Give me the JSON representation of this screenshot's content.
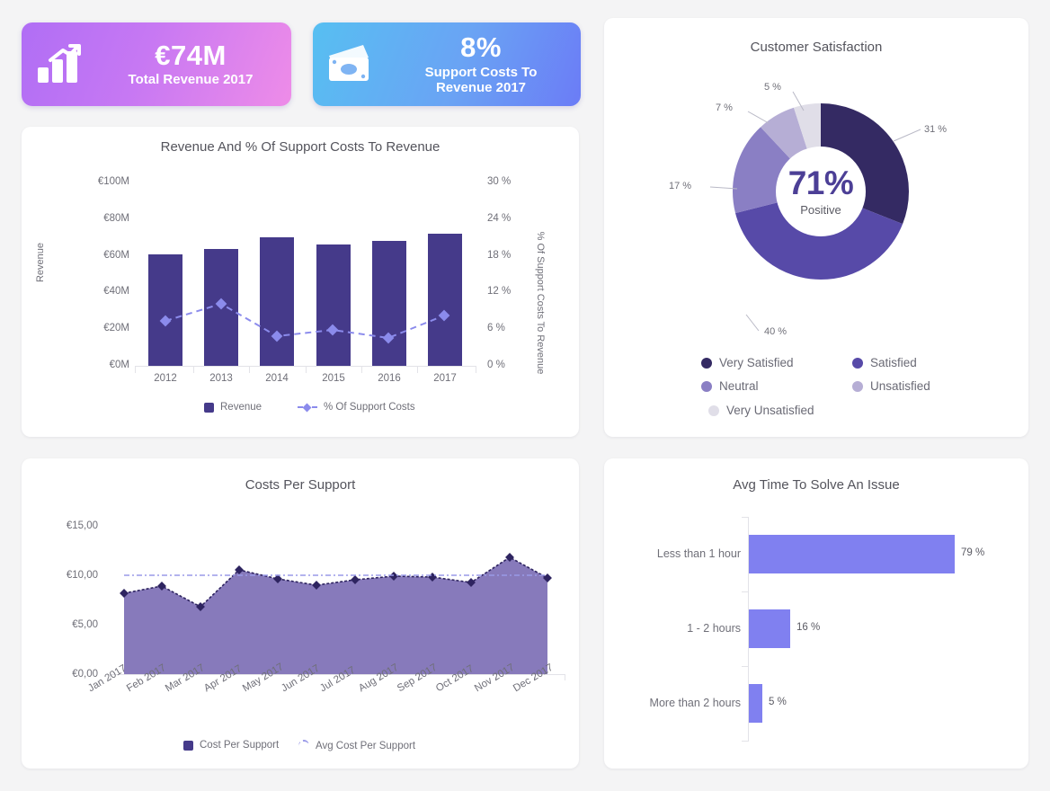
{
  "kpis": [
    {
      "id": "total-revenue",
      "icon": "bar-chart-growth-icon",
      "value": "€74M",
      "label_line1": "Total Revenue 2017",
      "label_line2": "",
      "color_from": "#b06ef5",
      "color_to": "#ee8ce8"
    },
    {
      "id": "support-costs",
      "icon": "money-cash-icon",
      "value": "8%",
      "label_line1": "Support Costs To",
      "label_line2": "Revenue 2017",
      "color_from": "#57bff2",
      "color_to": "#6b7cf6"
    }
  ],
  "chart_data": [
    {
      "id": "revenue-combo",
      "type": "bar",
      "title": "Revenue And % Of Support Costs To Revenue",
      "xlabel": "",
      "ylabel": "Revenue",
      "y2label": "% Of Support Costs To Revenue",
      "categories": [
        "2012",
        "2013",
        "2014",
        "2015",
        "2016",
        "2017"
      ],
      "ylim": [
        0,
        100
      ],
      "yticks": [
        "€0M",
        "€20M",
        "€40M",
        "€60M",
        "€80M",
        "€100M"
      ],
      "y2lim": [
        0,
        30
      ],
      "y2ticks": [
        "0 %",
        "6 %",
        "12 %",
        "18 %",
        "24 %",
        "30 %"
      ],
      "series": [
        {
          "name": "Revenue",
          "type": "bar",
          "color": "#453a8a",
          "values": [
            61,
            64,
            70,
            66,
            68,
            72
          ]
        },
        {
          "name": "% Of Support Costs",
          "type": "line",
          "color": "#8b8bec",
          "values": [
            7.4,
            10.3,
            5.0,
            6.0,
            4.7,
            8.4
          ]
        }
      ],
      "legend": [
        "Revenue",
        "% Of Support Costs"
      ],
      "grid": false,
      "legend_position": "bottom"
    },
    {
      "id": "customer-satisfaction",
      "type": "pie",
      "title": "Customer Satisfaction",
      "center_value": "71%",
      "center_label": "Positive",
      "labels": [
        "Very Satisfied",
        "Satisfied",
        "Neutral",
        "Unsatisfied",
        "Very Unsatisfied"
      ],
      "values": [
        31,
        40,
        17,
        7,
        5
      ],
      "value_labels": [
        "31 %",
        "40 %",
        "17 %",
        "7 %",
        "5 %"
      ],
      "colors": [
        "#342a63",
        "#574aa8",
        "#8a7fc4",
        "#b6aed5",
        "#e0dee8"
      ],
      "legend_position": "bottom"
    },
    {
      "id": "costs-per-support",
      "type": "area",
      "title": "Costs Per Support",
      "xlabel": "",
      "ylabel": "",
      "ylim": [
        0,
        15
      ],
      "yticks": [
        "€0,00",
        "€5,00",
        "€10,00",
        "€15,00"
      ],
      "categories": [
        "Jan 2017",
        "Feb 2017",
        "Mar 2017",
        "Apr 2017",
        "May 2017",
        "Jun 2017",
        "Jul 2017",
        "Aug 2017",
        "Sep 2017",
        "Oct 2017",
        "Nov 2017",
        "Dec 2017"
      ],
      "series": [
        {
          "name": "Cost Per Support",
          "type": "area",
          "color": "#7d6fb5",
          "values": [
            8.2,
            8.9,
            6.8,
            11.3,
            10.4,
            9.7,
            10.2,
            10.6,
            10.5,
            9.8,
            12.4,
            10.3,
            10.2
          ]
        },
        {
          "name": "Avg Cost Per Support",
          "type": "line",
          "color": "#9a9ae8",
          "value": 10.0
        }
      ],
      "legend": [
        "Cost Per Support",
        "Avg Cost Per Support"
      ],
      "legend_position": "bottom"
    },
    {
      "id": "avg-time-to-solve",
      "type": "bar",
      "orientation": "horizontal",
      "title": "Avg Time To Solve An Issue",
      "categories": [
        "Less than 1 hour",
        "1 - 2 hours",
        "More than 2 hours"
      ],
      "values": [
        79,
        16,
        5
      ],
      "value_labels": [
        "79 %",
        "16 %",
        "5 %"
      ],
      "color": "#8080f0",
      "xlim": [
        0,
        100
      ],
      "grid": false
    }
  ]
}
